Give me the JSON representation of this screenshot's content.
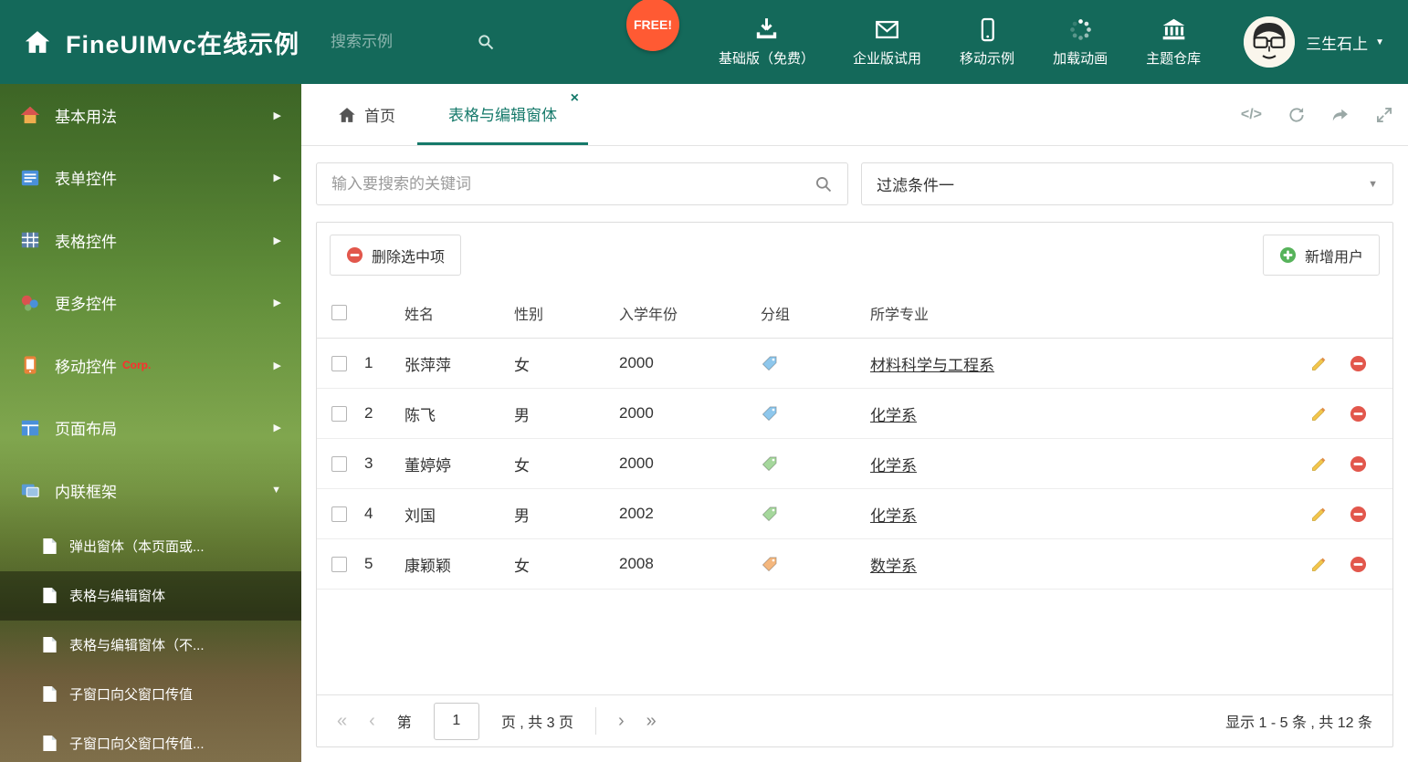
{
  "colors": {
    "header_bg": "#14695a",
    "accent": "#15796a",
    "delete_red": "#e2574c",
    "add_green": "#57b35b",
    "badge_orange": "#ff5a33"
  },
  "header": {
    "title": "FineUIMvc在线示例",
    "search_placeholder": "搜索示例",
    "free_badge": "FREE!",
    "nav": [
      {
        "label": "基础版（免费）",
        "icon": "download-icon"
      },
      {
        "label": "企业版试用",
        "icon": "envelope-icon"
      },
      {
        "label": "移动示例",
        "icon": "mobile-icon"
      },
      {
        "label": "加载动画",
        "icon": "spinner-icon"
      },
      {
        "label": "主题仓库",
        "icon": "bank-icon"
      }
    ],
    "user_name": "三生石上",
    "caret": "▼"
  },
  "sidebar": {
    "items": [
      {
        "label": "基本用法",
        "arrow": "▶"
      },
      {
        "label": "表单控件",
        "arrow": "▶"
      },
      {
        "label": "表格控件",
        "arrow": "▶"
      },
      {
        "label": "更多控件",
        "arrow": "▶"
      },
      {
        "label": "移动控件",
        "badge": "Corp.",
        "arrow": "▶"
      },
      {
        "label": "页面布局",
        "arrow": "▶"
      },
      {
        "label": "内联框架",
        "arrow": "▼"
      }
    ],
    "subitems": [
      {
        "label": "弹出窗体（本页面或..."
      },
      {
        "label": "表格与编辑窗体"
      },
      {
        "label": "表格与编辑窗体（不..."
      },
      {
        "label": "子窗口向父窗口传值"
      },
      {
        "label": "子窗口向父窗口传值..."
      }
    ]
  },
  "tabs": {
    "home": {
      "label": "首页"
    },
    "active": {
      "label": "表格与编辑窗体",
      "close": "×"
    }
  },
  "tab_tools": {
    "code": "</>"
  },
  "filters": {
    "search_placeholder": "输入要搜索的关键词",
    "filter_value": "过滤条件一",
    "caret": "▼"
  },
  "panel_toolbar": {
    "delete_label": "删除选中项",
    "add_label": "新增用户"
  },
  "table": {
    "columns": {
      "name": "姓名",
      "gender": "性别",
      "year": "入学年份",
      "group": "分组",
      "major": "所学专业"
    },
    "rows": [
      {
        "num": "1",
        "name": "张萍萍",
        "gender": "女",
        "year": "2000",
        "tag_color": "#8ec7ec",
        "major": "材料科学与工程系"
      },
      {
        "num": "2",
        "name": "陈飞",
        "gender": "男",
        "year": "2000",
        "tag_color": "#8ec7ec",
        "major": "化学系"
      },
      {
        "num": "3",
        "name": "董婷婷",
        "gender": "女",
        "year": "2000",
        "tag_color": "#a5d79c",
        "major": "化学系"
      },
      {
        "num": "4",
        "name": "刘国",
        "gender": "男",
        "year": "2002",
        "tag_color": "#a5d79c",
        "major": "化学系"
      },
      {
        "num": "5",
        "name": "康颖颖",
        "gender": "女",
        "year": "2008",
        "tag_color": "#f4b77e",
        "major": "数学系"
      }
    ]
  },
  "pagination": {
    "first": "«",
    "prev": "‹",
    "page_prefix": "第",
    "current_page": "1",
    "page_suffix": "页 , 共 3 页",
    "next": "›",
    "last": "»",
    "summary": "显示 1 - 5 条 , 共 12 条"
  }
}
